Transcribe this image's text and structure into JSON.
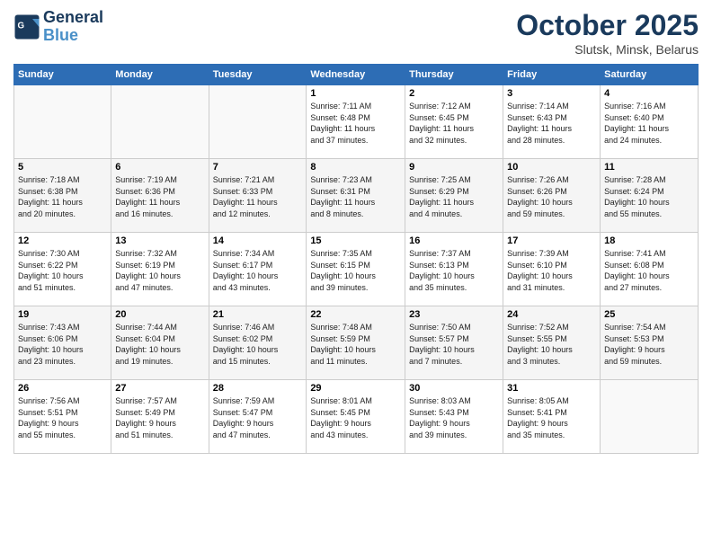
{
  "header": {
    "logo_line1": "General",
    "logo_line2": "Blue",
    "month": "October 2025",
    "location": "Slutsk, Minsk, Belarus"
  },
  "weekdays": [
    "Sunday",
    "Monday",
    "Tuesday",
    "Wednesday",
    "Thursday",
    "Friday",
    "Saturday"
  ],
  "weeks": [
    [
      {
        "day": "",
        "info": ""
      },
      {
        "day": "",
        "info": ""
      },
      {
        "day": "",
        "info": ""
      },
      {
        "day": "1",
        "info": "Sunrise: 7:11 AM\nSunset: 6:48 PM\nDaylight: 11 hours\nand 37 minutes."
      },
      {
        "day": "2",
        "info": "Sunrise: 7:12 AM\nSunset: 6:45 PM\nDaylight: 11 hours\nand 32 minutes."
      },
      {
        "day": "3",
        "info": "Sunrise: 7:14 AM\nSunset: 6:43 PM\nDaylight: 11 hours\nand 28 minutes."
      },
      {
        "day": "4",
        "info": "Sunrise: 7:16 AM\nSunset: 6:40 PM\nDaylight: 11 hours\nand 24 minutes."
      }
    ],
    [
      {
        "day": "5",
        "info": "Sunrise: 7:18 AM\nSunset: 6:38 PM\nDaylight: 11 hours\nand 20 minutes."
      },
      {
        "day": "6",
        "info": "Sunrise: 7:19 AM\nSunset: 6:36 PM\nDaylight: 11 hours\nand 16 minutes."
      },
      {
        "day": "7",
        "info": "Sunrise: 7:21 AM\nSunset: 6:33 PM\nDaylight: 11 hours\nand 12 minutes."
      },
      {
        "day": "8",
        "info": "Sunrise: 7:23 AM\nSunset: 6:31 PM\nDaylight: 11 hours\nand 8 minutes."
      },
      {
        "day": "9",
        "info": "Sunrise: 7:25 AM\nSunset: 6:29 PM\nDaylight: 11 hours\nand 4 minutes."
      },
      {
        "day": "10",
        "info": "Sunrise: 7:26 AM\nSunset: 6:26 PM\nDaylight: 10 hours\nand 59 minutes."
      },
      {
        "day": "11",
        "info": "Sunrise: 7:28 AM\nSunset: 6:24 PM\nDaylight: 10 hours\nand 55 minutes."
      }
    ],
    [
      {
        "day": "12",
        "info": "Sunrise: 7:30 AM\nSunset: 6:22 PM\nDaylight: 10 hours\nand 51 minutes."
      },
      {
        "day": "13",
        "info": "Sunrise: 7:32 AM\nSunset: 6:19 PM\nDaylight: 10 hours\nand 47 minutes."
      },
      {
        "day": "14",
        "info": "Sunrise: 7:34 AM\nSunset: 6:17 PM\nDaylight: 10 hours\nand 43 minutes."
      },
      {
        "day": "15",
        "info": "Sunrise: 7:35 AM\nSunset: 6:15 PM\nDaylight: 10 hours\nand 39 minutes."
      },
      {
        "day": "16",
        "info": "Sunrise: 7:37 AM\nSunset: 6:13 PM\nDaylight: 10 hours\nand 35 minutes."
      },
      {
        "day": "17",
        "info": "Sunrise: 7:39 AM\nSunset: 6:10 PM\nDaylight: 10 hours\nand 31 minutes."
      },
      {
        "day": "18",
        "info": "Sunrise: 7:41 AM\nSunset: 6:08 PM\nDaylight: 10 hours\nand 27 minutes."
      }
    ],
    [
      {
        "day": "19",
        "info": "Sunrise: 7:43 AM\nSunset: 6:06 PM\nDaylight: 10 hours\nand 23 minutes."
      },
      {
        "day": "20",
        "info": "Sunrise: 7:44 AM\nSunset: 6:04 PM\nDaylight: 10 hours\nand 19 minutes."
      },
      {
        "day": "21",
        "info": "Sunrise: 7:46 AM\nSunset: 6:02 PM\nDaylight: 10 hours\nand 15 minutes."
      },
      {
        "day": "22",
        "info": "Sunrise: 7:48 AM\nSunset: 5:59 PM\nDaylight: 10 hours\nand 11 minutes."
      },
      {
        "day": "23",
        "info": "Sunrise: 7:50 AM\nSunset: 5:57 PM\nDaylight: 10 hours\nand 7 minutes."
      },
      {
        "day": "24",
        "info": "Sunrise: 7:52 AM\nSunset: 5:55 PM\nDaylight: 10 hours\nand 3 minutes."
      },
      {
        "day": "25",
        "info": "Sunrise: 7:54 AM\nSunset: 5:53 PM\nDaylight: 9 hours\nand 59 minutes."
      }
    ],
    [
      {
        "day": "26",
        "info": "Sunrise: 7:56 AM\nSunset: 5:51 PM\nDaylight: 9 hours\nand 55 minutes."
      },
      {
        "day": "27",
        "info": "Sunrise: 7:57 AM\nSunset: 5:49 PM\nDaylight: 9 hours\nand 51 minutes."
      },
      {
        "day": "28",
        "info": "Sunrise: 7:59 AM\nSunset: 5:47 PM\nDaylight: 9 hours\nand 47 minutes."
      },
      {
        "day": "29",
        "info": "Sunrise: 8:01 AM\nSunset: 5:45 PM\nDaylight: 9 hours\nand 43 minutes."
      },
      {
        "day": "30",
        "info": "Sunrise: 8:03 AM\nSunset: 5:43 PM\nDaylight: 9 hours\nand 39 minutes."
      },
      {
        "day": "31",
        "info": "Sunrise: 8:05 AM\nSunset: 5:41 PM\nDaylight: 9 hours\nand 35 minutes."
      },
      {
        "day": "",
        "info": ""
      }
    ]
  ]
}
